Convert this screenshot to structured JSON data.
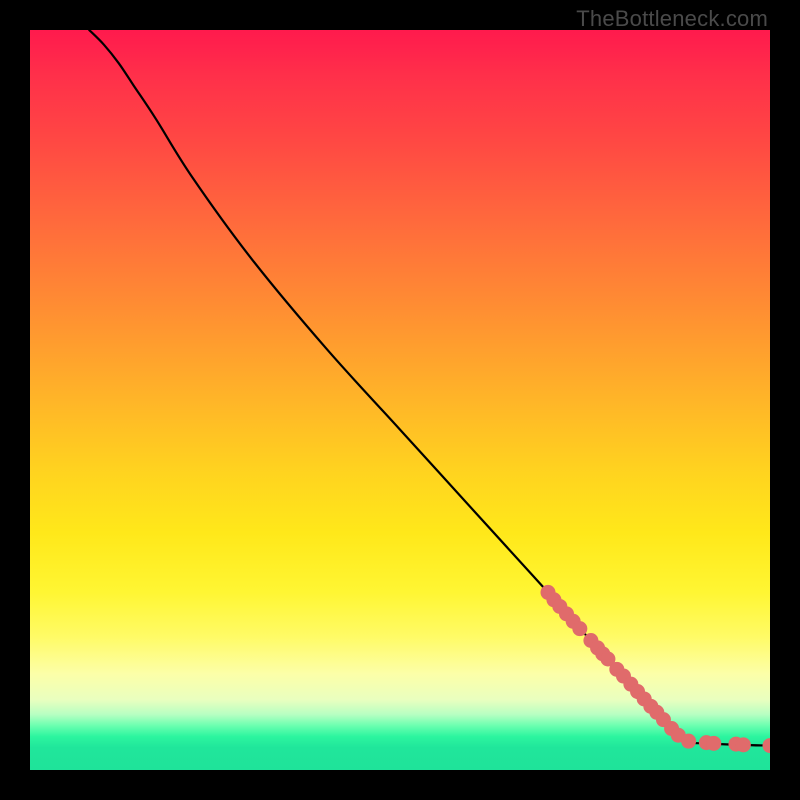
{
  "watermark": "TheBottleneck.com",
  "colors": {
    "dot": "#e06b6b",
    "curve": "#000000",
    "frame_bg": "#000000"
  },
  "chart_data": {
    "type": "line",
    "title": "",
    "xlabel": "",
    "ylabel": "",
    "xlim": [
      0,
      100
    ],
    "ylim": [
      0,
      100
    ],
    "grid": false,
    "legend": false,
    "note": "Axes unlabeled; values are plot-area percentages (x right, y up). Curve is a smooth monotonic decrease with a knee near (88,4) then flat to the right edge.",
    "series": [
      {
        "name": "curve",
        "kind": "line",
        "x": [
          8,
          10,
          12,
          14,
          17,
          22,
          30,
          40,
          50,
          60,
          70,
          78,
          84,
          88,
          92,
          96,
          100
        ],
        "y": [
          100,
          98,
          95.5,
          92.5,
          88,
          80,
          69,
          57,
          46,
          35,
          24,
          15,
          8.5,
          4.2,
          3.6,
          3.4,
          3.3
        ]
      },
      {
        "name": "highlighted-points",
        "kind": "scatter",
        "x": [
          70.0,
          70.8,
          71.6,
          72.5,
          73.4,
          74.3,
          75.8,
          76.7,
          77.4,
          78.1,
          79.3,
          80.2,
          81.2,
          82.1,
          83.0,
          83.9,
          84.7,
          85.6,
          86.7,
          87.6,
          89.0,
          91.4,
          92.4,
          95.4,
          96.4,
          100.0
        ],
        "y": [
          24.0,
          23.0,
          22.1,
          21.1,
          20.1,
          19.1,
          17.5,
          16.5,
          15.7,
          15.0,
          13.6,
          12.7,
          11.6,
          10.6,
          9.6,
          8.6,
          7.8,
          6.8,
          5.6,
          4.7,
          3.9,
          3.7,
          3.6,
          3.5,
          3.4,
          3.3
        ]
      }
    ]
  }
}
